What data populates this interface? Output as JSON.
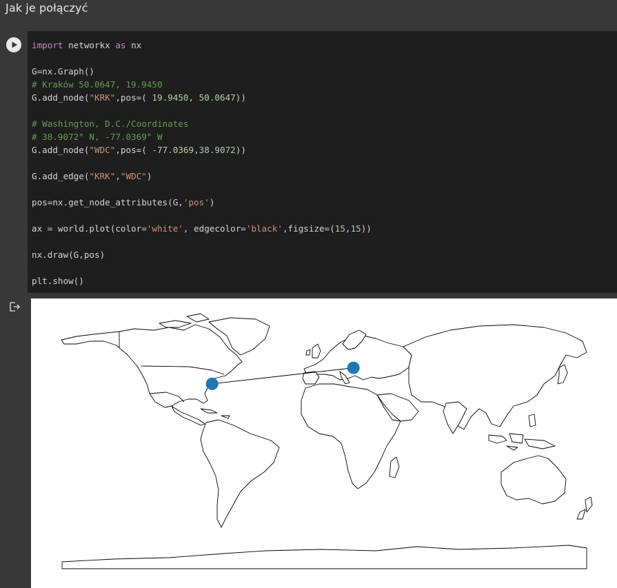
{
  "header": {
    "title": "Jak je połączyć"
  },
  "code_lines": [
    [
      [
        "kw",
        "import"
      ],
      [
        "t",
        " networkx "
      ],
      [
        "kw",
        "as"
      ],
      [
        "t",
        " nx"
      ]
    ],
    [],
    [
      [
        "t",
        "G=nx.Graph()"
      ]
    ],
    [
      [
        "cmt",
        "# Kraków 50.0647, 19.9450"
      ]
    ],
    [
      [
        "t",
        "G.add_node("
      ],
      [
        "str",
        "\"KRK\""
      ],
      [
        "t",
        ",pos=( "
      ],
      [
        "num",
        "19.9450"
      ],
      [
        "t",
        ", "
      ],
      [
        "num",
        "50.0647"
      ],
      [
        "t",
        "))"
      ]
    ],
    [],
    [
      [
        "cmt",
        "# Washington, D.C./Coordinates"
      ]
    ],
    [
      [
        "cmt",
        "# 38.9072° N, -77.0369° W"
      ]
    ],
    [
      [
        "t",
        "G.add_node("
      ],
      [
        "str",
        "\"WDC\""
      ],
      [
        "t",
        ",pos=( "
      ],
      [
        "num",
        "-77.0369"
      ],
      [
        "t",
        ","
      ],
      [
        "num",
        "38.9072"
      ],
      [
        "t",
        "))"
      ]
    ],
    [],
    [
      [
        "t",
        "G.add_edge("
      ],
      [
        "str",
        "\"KRK\""
      ],
      [
        "t",
        ","
      ],
      [
        "str",
        "\"WDC\""
      ],
      [
        "t",
        ")"
      ]
    ],
    [],
    [
      [
        "t",
        "pos=nx.get_node_attributes(G,"
      ],
      [
        "str",
        "'pos'"
      ],
      [
        "t",
        ")"
      ]
    ],
    [],
    [
      [
        "t",
        "ax = world.plot(color="
      ],
      [
        "str",
        "'white'"
      ],
      [
        "t",
        ", edgecolor="
      ],
      [
        "str",
        "'black'"
      ],
      [
        "t",
        ",figsize=("
      ],
      [
        "num",
        "15"
      ],
      [
        "t",
        ","
      ],
      [
        "num",
        "15"
      ],
      [
        "t",
        "))"
      ]
    ],
    [],
    [
      [
        "t",
        "nx.draw(G,pos)"
      ]
    ],
    [],
    [
      [
        "t",
        "plt.show()"
      ]
    ]
  ],
  "map": {
    "type": "world-map-network",
    "lon_range": [
      -180,
      180
    ],
    "lat_range": [
      -90,
      84
    ],
    "node_color": "#1f77b4",
    "edge_color": "#000000",
    "land_fill": "#ffffff",
    "land_stroke": "#000000",
    "nodes": [
      {
        "id": "KRK",
        "lon": 19.945,
        "lat": 50.0647
      },
      {
        "id": "WDC",
        "lon": -77.0369,
        "lat": 38.9072
      }
    ],
    "edges": [
      [
        "KRK",
        "WDC"
      ]
    ]
  },
  "colors": {
    "page_bg": "#383838",
    "code_bg": "#1e1e1e",
    "keyword": "#c586c0",
    "string": "#ce9178",
    "number": "#b5cea8",
    "comment": "#6a9955"
  },
  "icons": {
    "run": "play-icon",
    "output": "output-redirect-icon"
  }
}
